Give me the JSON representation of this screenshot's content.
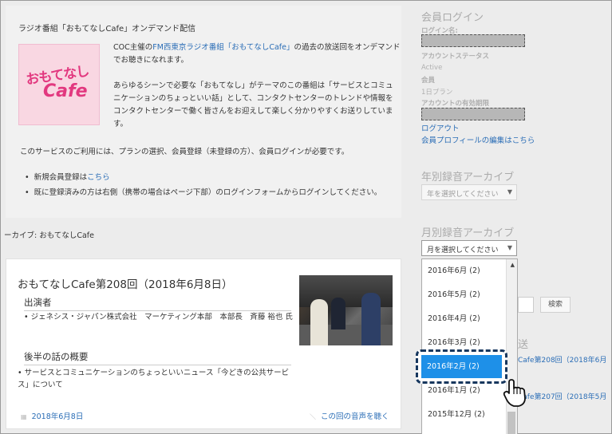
{
  "intro": {
    "title": "ラジオ番組「おもてなしCafe」オンデマンド配信",
    "logo_text_1": "おもてなし",
    "logo_text_2": "Cafe",
    "p1_a": "COC主催の",
    "p1_link": "FM西東京ラジオ番組「おもてなしCafe」",
    "p1_b": "の過去の放送回をオンデマンドでお聴きになれます。",
    "p2": "あらゆるシーンで必要な「おもてなし」がテーマのこの番組は「サービスとコミュニケーションのちょっといい話」として、コンタクトセンターのトレンドや情報をコンタクトセンターで働く皆さんをお迎えして楽しく分かりやすくお送りしています。",
    "p3": "このサービスのご利用には、プランの選択、会員登録（未登録の方）、会員ログインが必要です。",
    "bullet1_a": "新規会員登録は",
    "bullet1_link": "こちら",
    "bullet2": "既に登録済みの方は右側（携帯の場合はページ下部）のログインフォームからログインしてください。"
  },
  "breadcrumb": "ーカイブ: おもてなしCafe",
  "article": {
    "title": "おもてなしCafe第208回（2018年6月8日）",
    "section1": "出演者",
    "item1": "ジェネシス・ジャパン株式会社　マーケティング本部　本部長　斉藤 裕也 氏",
    "section2": "後半の話の概要",
    "item2": "サービスとコミュニケーションのちょっといいニュース「今どきの公共サービス」について",
    "date": "2018年6月8日",
    "listen": "この回の音声を聴く"
  },
  "sidebar": {
    "login_heading": "会員ログイン",
    "login_name_label": "ログイン名:",
    "account_status_label": "アカウントステータス",
    "account_status_value": "Active",
    "member_label": "会員",
    "plan_value": "1日プラン",
    "expiry_label": "アカウントの有効期限",
    "logout": "ログアウト",
    "edit_profile": "会員プロフィールの編集はこちら",
    "year_heading": "年別録音アーカイブ",
    "year_select": "年を選択してください",
    "month_heading": "月別録音アーカイブ",
    "month_select": "月を選択してください",
    "options": [
      "2016年6月 (2)",
      "2016年5月 (2)",
      "2016年4月 (2)",
      "2016年3月 (2)",
      "2016年2月 (2)",
      "2016年1月 (2)",
      "2015年12月 (2)"
    ],
    "search_button": "検索",
    "snip_1": "送",
    "snip_2": "Cafe第208回（2018年6月",
    "snip_3": "Cafe第207回（2018年5月"
  }
}
